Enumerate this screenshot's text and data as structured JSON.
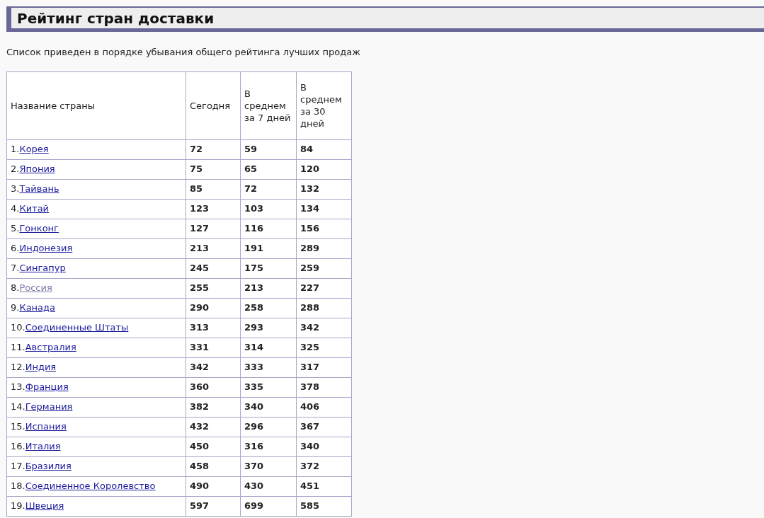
{
  "title": "Рейтинг стран доставки",
  "description": "Список приведен в порядке убывания общего рейтинга лучших продаж",
  "table": {
    "columns": [
      "Название страны",
      "Сегодня",
      "В среднем за 7 дней",
      "В среднем за 30 дней"
    ],
    "rows": [
      {
        "rank": "1.",
        "country": "Корея",
        "visited": false,
        "today": "72",
        "avg7": "59",
        "avg30": "84"
      },
      {
        "rank": "2.",
        "country": "Япония",
        "visited": false,
        "today": "75",
        "avg7": "65",
        "avg30": "120"
      },
      {
        "rank": "3.",
        "country": "Тайвань",
        "visited": false,
        "today": "85",
        "avg7": "72",
        "avg30": "132"
      },
      {
        "rank": "4.",
        "country": "Китай",
        "visited": false,
        "today": "123",
        "avg7": "103",
        "avg30": "134"
      },
      {
        "rank": "5.",
        "country": "Гонконг",
        "visited": false,
        "today": "127",
        "avg7": "116",
        "avg30": "156"
      },
      {
        "rank": "6.",
        "country": "Индонезия",
        "visited": false,
        "today": "213",
        "avg7": "191",
        "avg30": "289"
      },
      {
        "rank": "7.",
        "country": "Сингапур",
        "visited": false,
        "today": "245",
        "avg7": "175",
        "avg30": "259"
      },
      {
        "rank": "8.",
        "country": "Россия",
        "visited": true,
        "today": "255",
        "avg7": "213",
        "avg30": "227"
      },
      {
        "rank": "9.",
        "country": "Канада",
        "visited": false,
        "today": "290",
        "avg7": "258",
        "avg30": "288"
      },
      {
        "rank": "10.",
        "country": "Соединенные Штаты",
        "visited": false,
        "today": "313",
        "avg7": "293",
        "avg30": "342"
      },
      {
        "rank": "11.",
        "country": "Австралия",
        "visited": false,
        "today": "331",
        "avg7": "314",
        "avg30": "325"
      },
      {
        "rank": "12.",
        "country": "Индия",
        "visited": false,
        "today": "342",
        "avg7": "333",
        "avg30": "317"
      },
      {
        "rank": "13.",
        "country": "Франция",
        "visited": false,
        "today": "360",
        "avg7": "335",
        "avg30": "378"
      },
      {
        "rank": "14.",
        "country": "Германия",
        "visited": false,
        "today": "382",
        "avg7": "340",
        "avg30": "406"
      },
      {
        "rank": "15.",
        "country": "Испания",
        "visited": false,
        "today": "432",
        "avg7": "296",
        "avg30": "367"
      },
      {
        "rank": "16.",
        "country": "Италия",
        "visited": false,
        "today": "450",
        "avg7": "316",
        "avg30": "340"
      },
      {
        "rank": "17.",
        "country": "Бразилия",
        "visited": false,
        "today": "458",
        "avg7": "370",
        "avg30": "372"
      },
      {
        "rank": "18.",
        "country": "Соединенное Королевство",
        "visited": false,
        "today": "490",
        "avg7": "430",
        "avg30": "451"
      },
      {
        "rank": "19.",
        "country": "Швеция",
        "visited": false,
        "today": "597",
        "avg7": "699",
        "avg30": "585"
      }
    ]
  }
}
